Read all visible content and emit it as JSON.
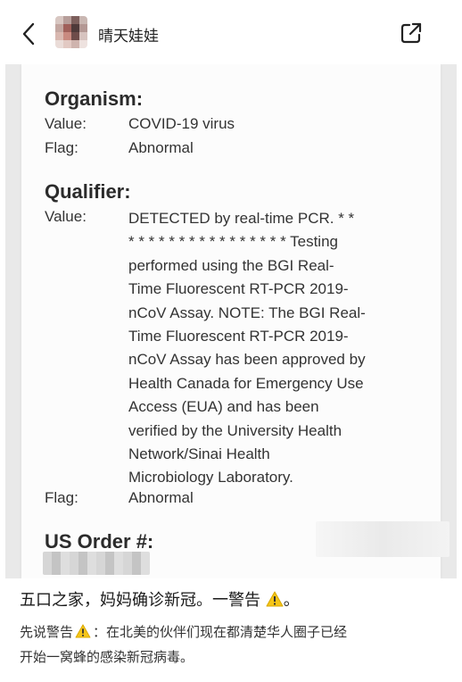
{
  "header": {
    "back_icon": "chevron-left-icon",
    "username": "晴天娃娃",
    "share_icon": "share-external-icon"
  },
  "document": {
    "organism": {
      "title": "Organism:",
      "value_label": "Value:",
      "value": "COVID-19 virus",
      "flag_label": "Flag:",
      "flag": "Abnormal"
    },
    "qualifier": {
      "title": "Qualifier:",
      "value_label": "Value:",
      "value_lines": [
        "DETECTED by real-time PCR. * *",
        "* * * * * * * * * * * * * * * * Testing",
        "performed using the BGI Real-",
        "Time Fluorescent RT-PCR 2019-",
        "nCoV Assay. NOTE: The BGI Real-",
        "Time Fluorescent RT-PCR 2019-",
        "nCoV Assay has been approved by",
        "Health Canada for Emergency Use",
        "Access (EUA) and has been",
        "verified by the University Health",
        "Network/Sinai Health",
        "Microbiology Laboratory."
      ],
      "flag_label": "Flag:",
      "flag": "Abnormal"
    },
    "order": {
      "title": "US Order #:"
    }
  },
  "post": {
    "title_text": "五口之家，妈妈确诊新冠。一警告",
    "title_end": "。",
    "body_line1_a": "先说警告",
    "body_line1_b": "：在北美的伙伴们现在都清楚华人圈子已经",
    "body_line2": "开始一窝蜂的感染新冠病毒。",
    "warning_icon": "warning-icon",
    "warning_color": "#f5c518"
  }
}
